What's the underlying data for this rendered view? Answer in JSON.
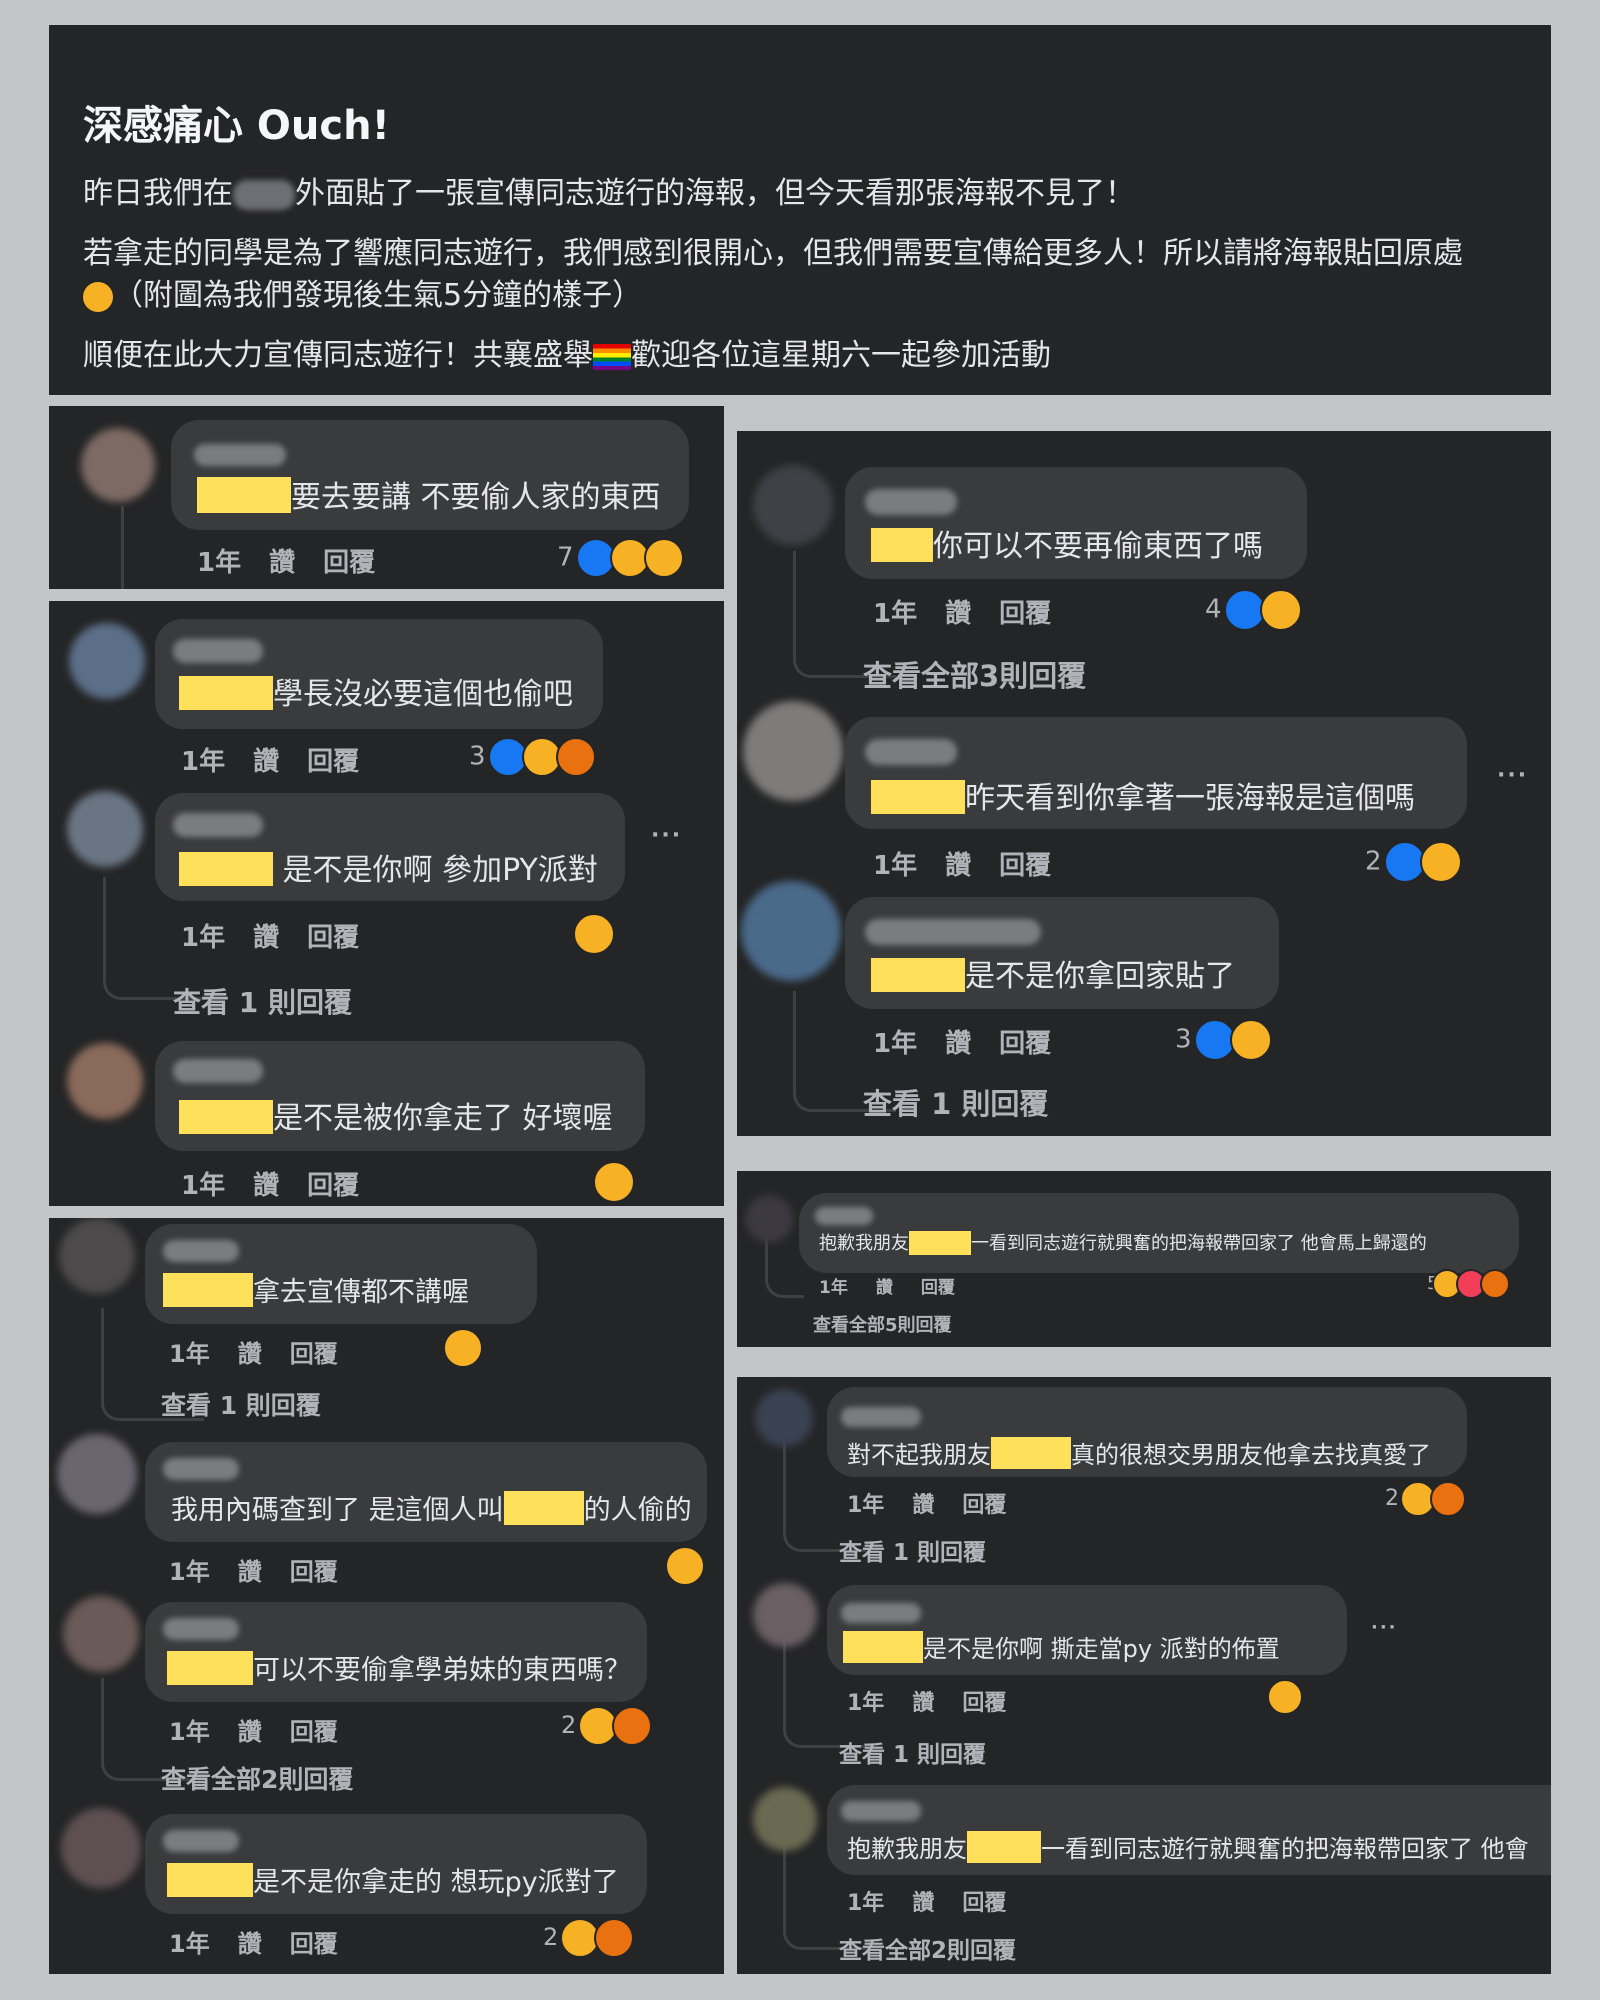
{
  "post": {
    "title": "深感痛心 Ouch!",
    "line1_a": "昨日我們在",
    "line1_b": "外面貼了一張宣傳同志遊行的海報，但今天看那張海報不見了！",
    "line2_a": "若拿走的同學是為了響應同志遊行，我們感到很開心，但我們需要宣傳給更多人！所以請將海報貼回原處",
    "line2_b": "（附圖為我們發現後生氣5分鐘的樣子）",
    "line3_a": "順便在此大力宣傳同志遊行！共襄盛舉",
    "line3_b": "歡迎各位這星期六一起參加活動"
  },
  "labels": {
    "time": "1年",
    "like": "讚",
    "reply": "回覆",
    "more": "···"
  },
  "comments": [
    {
      "pre": "",
      "text": "要去要講 不要偷人家的東西",
      "count": "7"
    },
    {
      "pre": "",
      "text": "學長沒必要這個也偷吧",
      "count": "3"
    },
    {
      "pre": "",
      "text": " 是不是你啊 參加PY派對",
      "count": "",
      "replies": "查看 1 則回覆"
    },
    {
      "pre": "",
      "text": "是不是被你拿走了 好壞喔",
      "count": ""
    },
    {
      "pre": "",
      "text": "拿去宣傳都不講喔",
      "count": "",
      "replies": "查看 1 則回覆"
    },
    {
      "pre": "我用內碼查到了 是這個人叫",
      "text": "的人偷的",
      "count": ""
    },
    {
      "pre": "",
      "text": "可以不要偷拿學弟妹的東西嗎？",
      "count": "2",
      "replies": "查看全部2則回覆"
    },
    {
      "pre": "",
      "text": "是不是你拿走的 想玩py派對了",
      "count": "2"
    },
    {
      "pre": "",
      "text": "你可以不要再偷東西了嗎",
      "count": "4",
      "replies": "查看全部3則回覆"
    },
    {
      "pre": "",
      "text": "昨天看到你拿著一張海報是這個嗎",
      "count": "2"
    },
    {
      "pre": "",
      "text": "是不是你拿回家貼了",
      "count": "3",
      "replies": "查看 1 則回覆"
    },
    {
      "pre": "抱歉我朋友",
      "text": "一看到同志遊行就興奮的把海報帶回家了 他會馬上歸還的",
      "count": "5",
      "replies": "查看全部5則回覆"
    },
    {
      "pre": "對不起我朋友",
      "text": "真的很想交男朋友他拿去找真愛了",
      "count": "2",
      "replies": "查看 1 則回覆"
    },
    {
      "pre": "",
      "text": "是不是你啊 撕走當py 派對的佈置",
      "count": "",
      "replies": "查看 1 則回覆"
    },
    {
      "pre": "抱歉我朋友",
      "text": "一看到同志遊行就興奮的把海報帶回家了 他會",
      "count": "",
      "replies": "查看全部2則回覆"
    }
  ],
  "colors": {
    "page_bg": "#c3c6c6",
    "panel_bg": "#18191a",
    "bubble_bg": "#3a3b3c",
    "mask": "#ffe05a",
    "like": "#1877f2",
    "sad": "#f7b125",
    "angry": "#e9710f"
  },
  "icons": [
    "like-reaction-icon",
    "sad-reaction-icon",
    "angry-reaction-icon",
    "laugh-reaction-icon",
    "love-reaction-icon",
    "rainbow-flag-icon",
    "more-options-icon"
  ]
}
